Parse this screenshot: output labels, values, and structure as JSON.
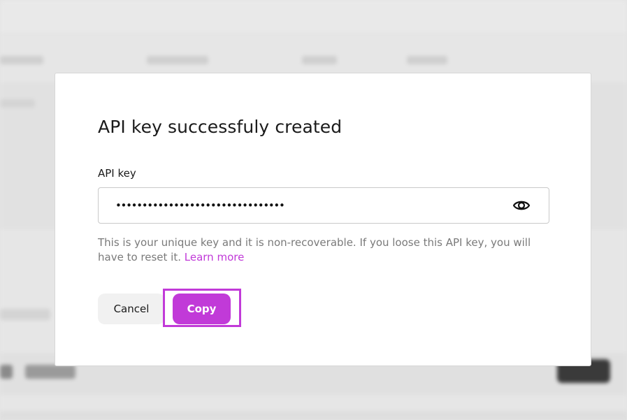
{
  "modal": {
    "title": "API key successfuly created",
    "field_label": "API key",
    "key_masked": "••••••••••••••••••••••••••••••••",
    "visibility_icon": "eye-icon",
    "help_text": "This is your unique key and it is non-recoverable. If you loose this API key, you will have to reset it.",
    "learn_more_label": "Learn more",
    "cancel_label": "Cancel",
    "copy_label": "Copy"
  },
  "colors": {
    "accent": "#c13ad8",
    "text": "#1a1a1a",
    "muted": "#7a7a7a",
    "overlay": "#e3e3e3"
  }
}
